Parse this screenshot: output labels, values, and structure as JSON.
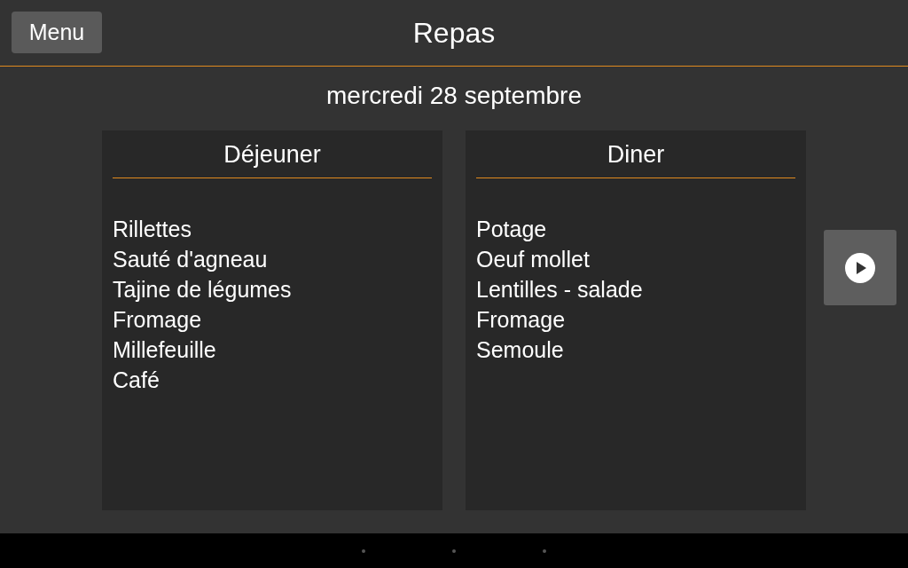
{
  "top_bar": {
    "menu_button": "Menu",
    "title": "Repas"
  },
  "date": "mercredi 28 septembre",
  "meals": [
    {
      "title": "Déjeuner",
      "items": [
        "Rillettes",
        "Sauté d'agneau",
        "Tajine de légumes",
        "Fromage",
        "Millefeuille",
        "Café"
      ]
    },
    {
      "title": "Diner",
      "items": [
        "Potage",
        "Oeuf mollet",
        "Lentilles - salade",
        "Fromage",
        "Semoule"
      ]
    }
  ]
}
